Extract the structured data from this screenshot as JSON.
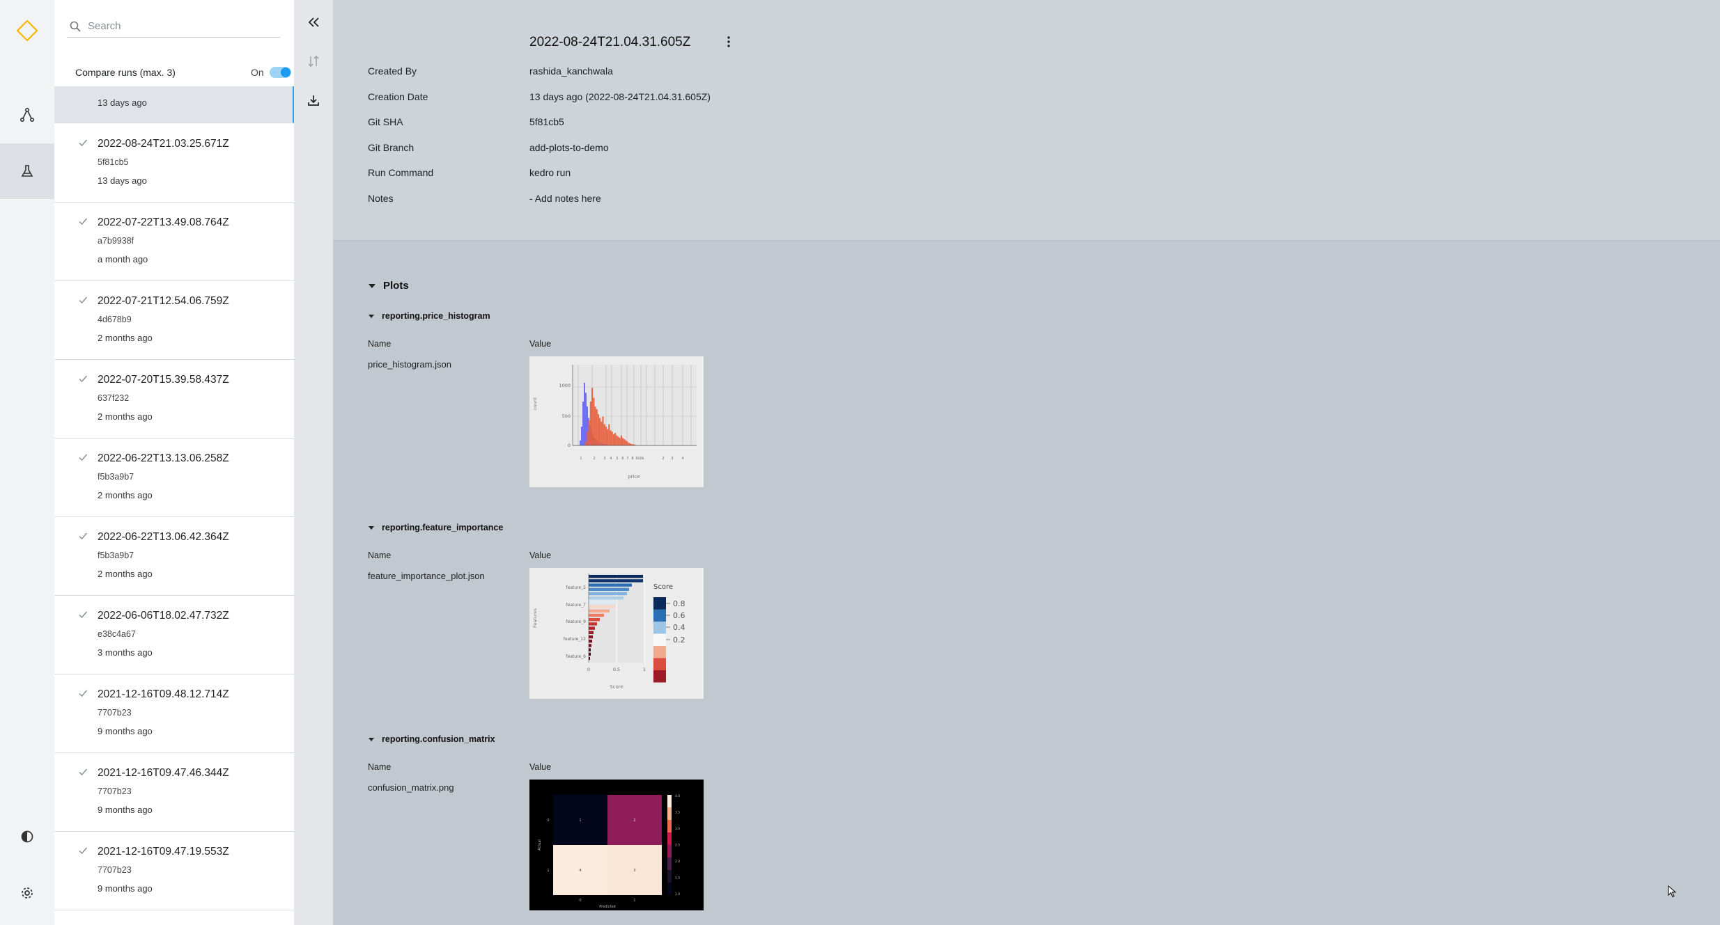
{
  "search": {
    "placeholder": "Search"
  },
  "compare": {
    "label": "Compare runs (max. 3)",
    "state": "On"
  },
  "runs": {
    "first_time": "13 days ago",
    "items": [
      {
        "title": "2022-08-24T21.03.25.671Z",
        "sha": "5f81cb5",
        "time": "13 days ago"
      },
      {
        "title": "2022-07-22T13.49.08.764Z",
        "sha": "a7b9938f",
        "time": "a month ago"
      },
      {
        "title": "2022-07-21T12.54.06.759Z",
        "sha": "4d678b9",
        "time": "2 months ago"
      },
      {
        "title": "2022-07-20T15.39.58.437Z",
        "sha": "637f232",
        "time": "2 months ago"
      },
      {
        "title": "2022-06-22T13.13.06.258Z",
        "sha": "f5b3a9b7",
        "time": "2 months ago"
      },
      {
        "title": "2022-06-22T13.06.42.364Z",
        "sha": "f5b3a9b7",
        "time": "2 months ago"
      },
      {
        "title": "2022-06-06T18.02.47.732Z",
        "sha": "e38c4a67",
        "time": "3 months ago"
      },
      {
        "title": "2021-12-16T09.48.12.714Z",
        "sha": "7707b23",
        "time": "9 months ago"
      },
      {
        "title": "2021-12-16T09.47.46.344Z",
        "sha": "7707b23",
        "time": "9 months ago"
      },
      {
        "title": "2021-12-16T09.47.19.553Z",
        "sha": "7707b23",
        "time": "9 months ago"
      }
    ]
  },
  "details": {
    "title": "2022-08-24T21.04.31.605Z",
    "meta": [
      {
        "key": "Created By",
        "value": "rashida_kanchwala"
      },
      {
        "key": "Creation Date",
        "value": "13 days ago (2022-08-24T21.04.31.605Z)"
      },
      {
        "key": "Git SHA",
        "value": "5f81cb5"
      },
      {
        "key": "Git Branch",
        "value": "add-plots-to-demo"
      },
      {
        "key": "Run Command",
        "value": "kedro run"
      },
      {
        "key": "Notes",
        "value": "- Add notes here"
      }
    ]
  },
  "plots": {
    "section_title": "Plots",
    "name_header": "Name",
    "value_header": "Value",
    "datasets": [
      {
        "title": "reporting.price_histogram",
        "file": "price_histogram.json"
      },
      {
        "title": "reporting.feature_importance",
        "file": "feature_importance_plot.json"
      },
      {
        "title": "reporting.confusion_matrix",
        "file": "confusion_matrix.png"
      }
    ]
  },
  "thumbs": {
    "hist": {
      "yticks": [
        "1000",
        "500",
        "0"
      ],
      "ylabel": "count",
      "xlabel": "price",
      "xticks": [
        "1",
        "2",
        "3",
        "4",
        "5",
        "6",
        "7",
        "8",
        "9",
        "10k",
        "2",
        "3",
        "4"
      ]
    },
    "fi": {
      "ylabel": "Features",
      "ylabels": [
        "feature_5",
        "feature_7",
        "feature_9",
        "feature_12",
        "feature_6"
      ],
      "xticks": [
        "0",
        "0.5",
        "1"
      ],
      "xlabel": "Score",
      "legend_title": "Score",
      "legend_ticks": [
        "0.8",
        "0.6",
        "0.4",
        "0.2"
      ]
    },
    "cm": {
      "ylabel": "Actual",
      "yticks": [
        "0",
        "1"
      ],
      "xlabel": "Predicted",
      "xticks": [
        "0",
        "1"
      ],
      "cells": [
        "1",
        "2",
        "4",
        "3"
      ],
      "colorbar_ticks": [
        "4.0",
        "3.5",
        "3.0",
        "2.5",
        "2.0",
        "1.5",
        "1.0"
      ]
    }
  },
  "colors": {
    "accent": "#1a9bef",
    "logo": "#f5b700"
  }
}
